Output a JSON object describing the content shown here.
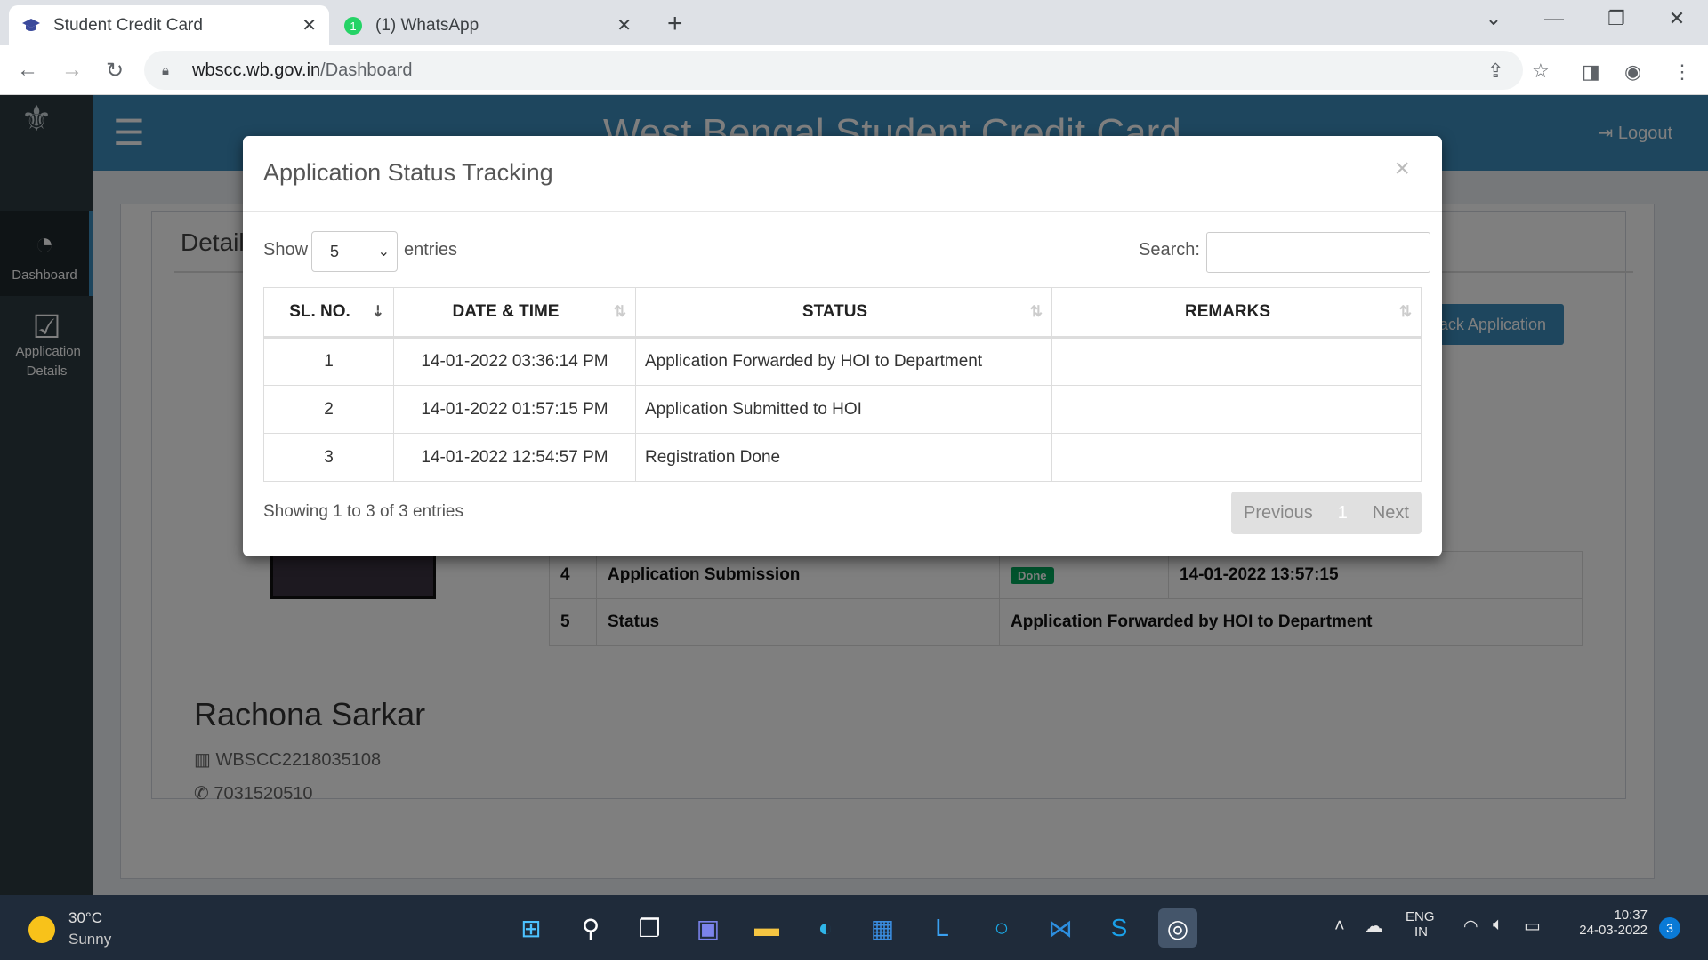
{
  "browser": {
    "tabs": [
      {
        "title": "Student Credit Card",
        "icon": "graduation-cap-icon"
      },
      {
        "title": "(1) WhatsApp",
        "icon": "whatsapp-icon"
      }
    ],
    "url_host": "wbscc.wb.gov.in",
    "url_path": "/Dashboard"
  },
  "site": {
    "title": "West Bengal Student Credit Card",
    "logout": "Logout",
    "sidebar": [
      {
        "label": "Dashboard",
        "icon": "dashboard-gauge-icon"
      },
      {
        "label": "Application Details",
        "icon": "checkbox-icon"
      }
    ]
  },
  "background": {
    "section_heading": "Details",
    "track_button": "Track Application",
    "rows": [
      {
        "no": "4",
        "label": "Application Submission",
        "badge": "Done",
        "date": "14-01-2022 13:57:15"
      },
      {
        "no": "5",
        "label": "Status",
        "value": "Application Forwarded by HOI to Department"
      }
    ],
    "profile": {
      "name": "Rachona Sarkar",
      "id": "WBSCC2218035108",
      "phone": "7031520510"
    }
  },
  "modal": {
    "title": "Application Status Tracking",
    "close": "×",
    "show_label": "Show",
    "entries_value": "5",
    "entries_label": "entries",
    "search_label": "Search:",
    "search_value": "",
    "columns": [
      "SL. NO.",
      "DATE & TIME",
      "STATUS",
      "REMARKS"
    ],
    "rows": [
      {
        "sl": "1",
        "datetime": "14-01-2022 03:36:14 PM",
        "status": "Application Forwarded by HOI to Department",
        "remarks": ""
      },
      {
        "sl": "2",
        "datetime": "14-01-2022 01:57:15 PM",
        "status": "Application Submitted to HOI",
        "remarks": ""
      },
      {
        "sl": "3",
        "datetime": "14-01-2022 12:54:57 PM",
        "status": "Registration Done",
        "remarks": ""
      }
    ],
    "info": "Showing 1 to 3 of 3 entries",
    "pager": {
      "previous": "Previous",
      "current": "1",
      "next": "Next"
    }
  },
  "taskbar": {
    "temp": "30°C",
    "weather": "Sunny",
    "lang1": "ENG",
    "lang2": "IN",
    "time": "10:37",
    "date": "24-03-2022",
    "notifications": "3"
  }
}
